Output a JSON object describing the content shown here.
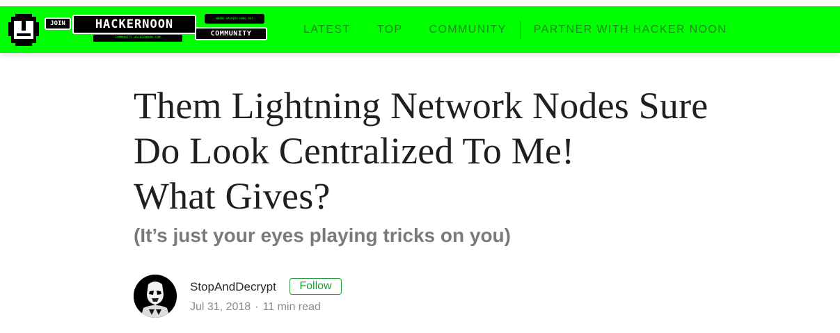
{
  "header": {
    "logo": {
      "join_text": "JOIN",
      "brand_text": "HACKERNOON",
      "url_text": "COMMUNITY.HACKERNOON.COM",
      "tag_text": "WHERE HACKERS HANG OUT",
      "community_text": "COMMUNITY"
    },
    "nav": [
      {
        "label": "LATEST"
      },
      {
        "label": "TOP"
      },
      {
        "label": "COMMUNITY"
      },
      {
        "label": "PARTNER WITH HACKER NOON"
      }
    ]
  },
  "article": {
    "title_lines": [
      "Them Lightning Network Nodes Sure",
      "Do Look Centralized To Me!",
      "What Gives?"
    ],
    "subtitle": "(It’s just your eyes playing tricks on you)",
    "author": {
      "name": "StopAndDecrypt",
      "follow_label": "Follow",
      "date": "Jul 31, 2018",
      "separator": "·",
      "read_time": "11 min read"
    }
  },
  "colors": {
    "brand_green": "#00ff00",
    "nav_text": "#1a8a1a",
    "follow_green": "#1f9e3a"
  }
}
